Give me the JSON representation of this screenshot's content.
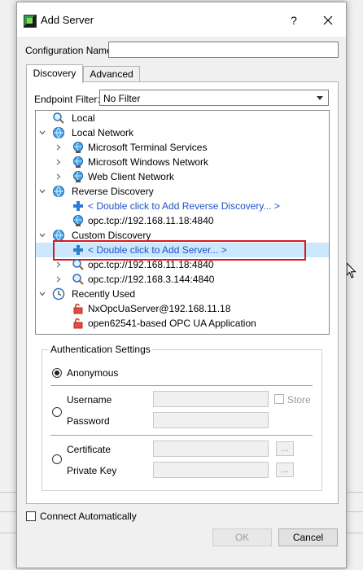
{
  "window": {
    "title": "Add Server",
    "help_label": "?"
  },
  "form": {
    "config_name_label": "Configuration Name",
    "config_name_value": ""
  },
  "tabs": [
    {
      "label": "Discovery"
    },
    {
      "label": "Advanced"
    }
  ],
  "endpoint_filter": {
    "label": "Endpoint Filter:",
    "value": "No Filter"
  },
  "tree": {
    "local": "Local",
    "local_network": "Local Network",
    "ln_items": [
      "Microsoft Terminal Services",
      "Microsoft Windows Network",
      "Web Client Network"
    ],
    "reverse": "Reverse Discovery",
    "reverse_add": "< Double click to Add Reverse Discovery... >",
    "reverse_url": "opc.tcp://192.168.11.18:4840",
    "custom": "Custom Discovery",
    "custom_add": "< Double click to Add Server... >",
    "custom_urls": [
      "opc.tcp://192.168.11.18:4840",
      "opc.tcp://192.168.3.144:4840"
    ],
    "recent": "Recently Used",
    "recent_items": [
      "NxOpcUaServer@192.168.11.18",
      "open62541-based OPC UA Application"
    ]
  },
  "auth": {
    "title": "Authentication Settings",
    "anonymous": "Anonymous",
    "username": "Username",
    "password": "Password",
    "store": "Store",
    "certificate": "Certificate",
    "private_key": "Private Key",
    "browse": "..."
  },
  "footer": {
    "connect_auto": "Connect Automatically",
    "ok": "OK",
    "cancel": "Cancel"
  },
  "colors": {
    "selection": "#cce8ff",
    "highlight_border": "#d7191f",
    "link": "#1d52c8"
  }
}
